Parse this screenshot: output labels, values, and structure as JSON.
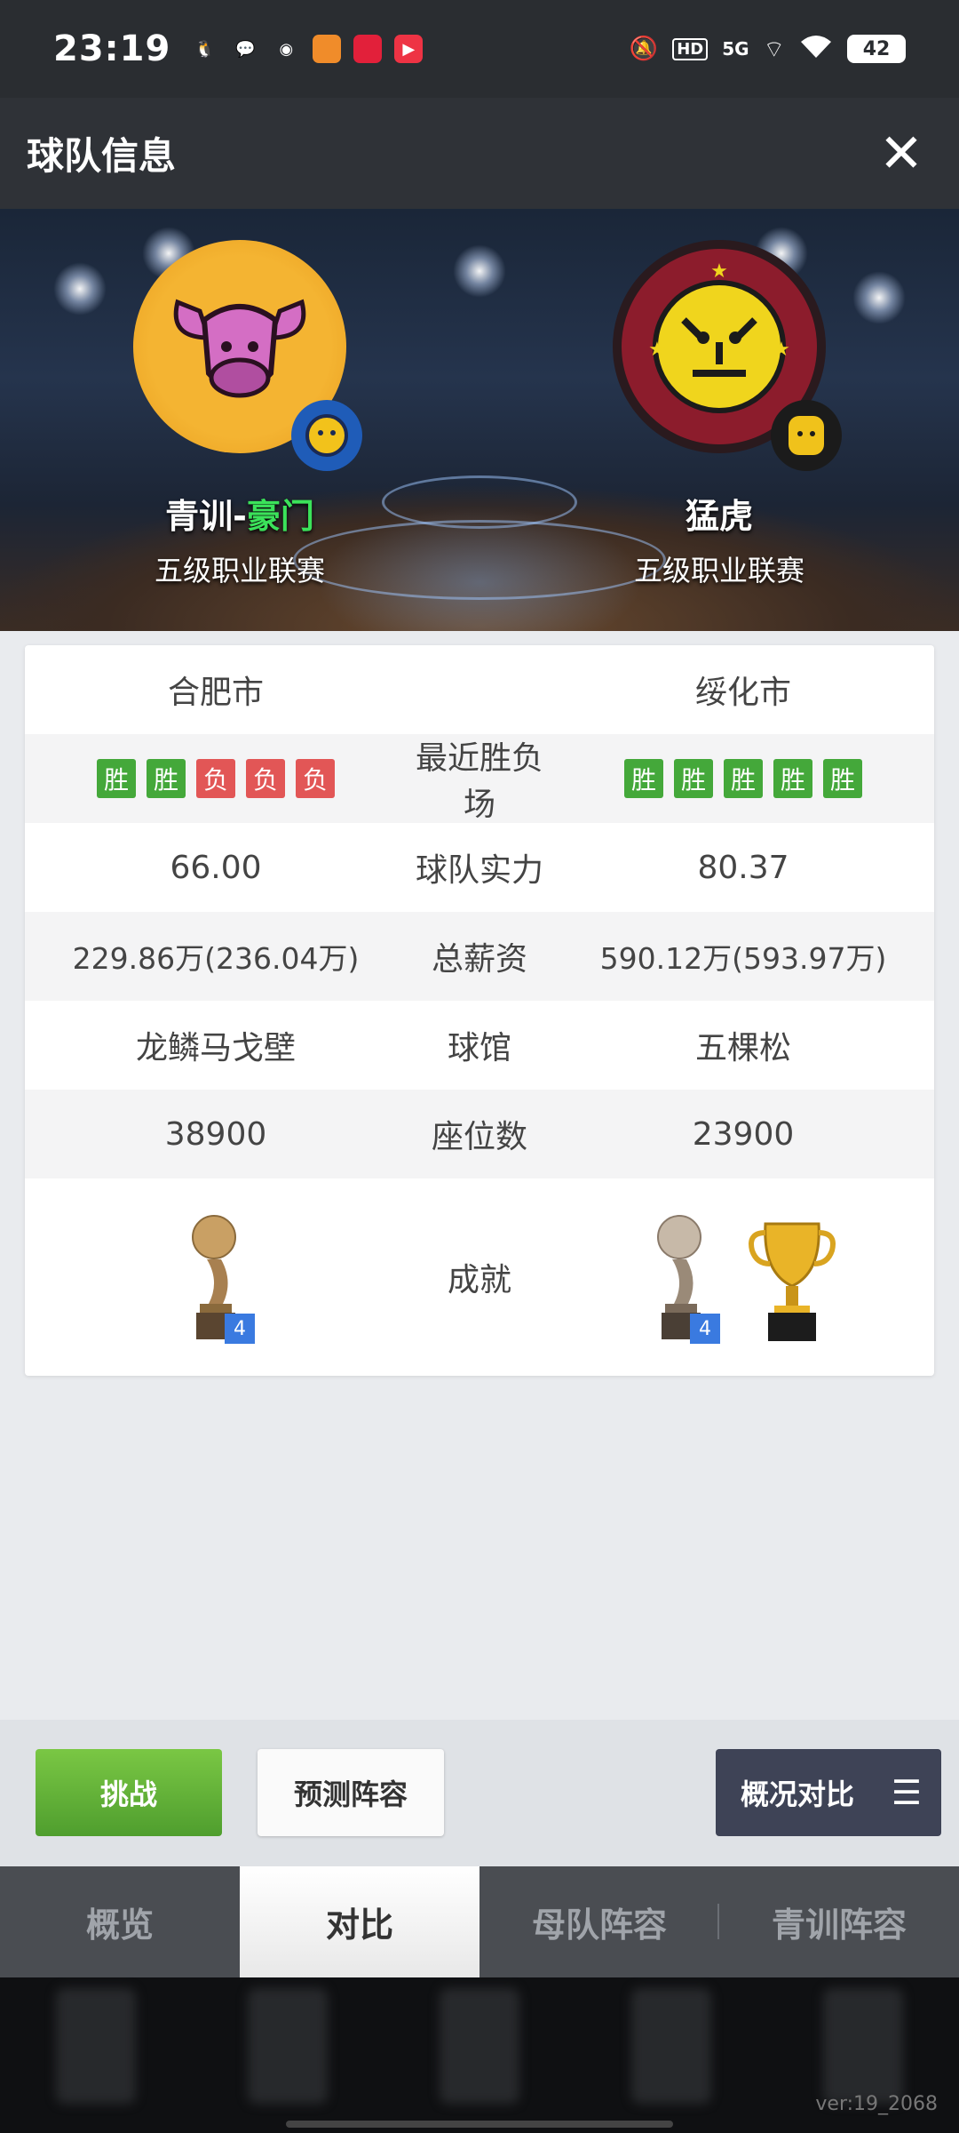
{
  "status_bar": {
    "time": "23:19",
    "network": "5G",
    "hd": "HD",
    "battery": "42"
  },
  "header": {
    "title": "球队信息",
    "close": "✕"
  },
  "teams": {
    "left": {
      "name_prefix": "青训-",
      "name_highlight": "豪门",
      "league": "五级职业联赛"
    },
    "right": {
      "name": "猛虎",
      "league": "五级职业联赛"
    }
  },
  "compare": {
    "city": {
      "left": "合肥市",
      "right": "绥化市"
    },
    "recent": {
      "label": "最近胜负场",
      "left": [
        {
          "text": "胜",
          "type": "win"
        },
        {
          "text": "胜",
          "type": "win"
        },
        {
          "text": "负",
          "type": "loss"
        },
        {
          "text": "负",
          "type": "loss"
        },
        {
          "text": "负",
          "type": "loss"
        }
      ],
      "right": [
        {
          "text": "胜",
          "type": "win"
        },
        {
          "text": "胜",
          "type": "win"
        },
        {
          "text": "胜",
          "type": "win"
        },
        {
          "text": "胜",
          "type": "win"
        },
        {
          "text": "胜",
          "type": "win"
        }
      ]
    },
    "strength": {
      "label": "球队实力",
      "left": "66.00",
      "right": "80.37"
    },
    "salary": {
      "label": "总薪资",
      "left": "229.86万(236.04万)",
      "right": "590.12万(593.97万)"
    },
    "arena": {
      "label": "球馆",
      "left": "龙鳞马戈壁",
      "right": "五棵松"
    },
    "seats": {
      "label": "座位数",
      "left": "38900",
      "right": "23900"
    },
    "achievement": {
      "label": "成就",
      "left_count": "4",
      "right_count": "4"
    }
  },
  "actions": {
    "challenge": "挑战",
    "predict": "预测阵容",
    "overview": "概况对比",
    "menu_icon": "☰"
  },
  "tabs": [
    {
      "label": "概览",
      "active": false
    },
    {
      "label": "对比",
      "active": true
    },
    {
      "label": "母队阵容",
      "active": false
    },
    {
      "label": "青训阵容",
      "active": false
    }
  ],
  "version": "ver:19_2068"
}
